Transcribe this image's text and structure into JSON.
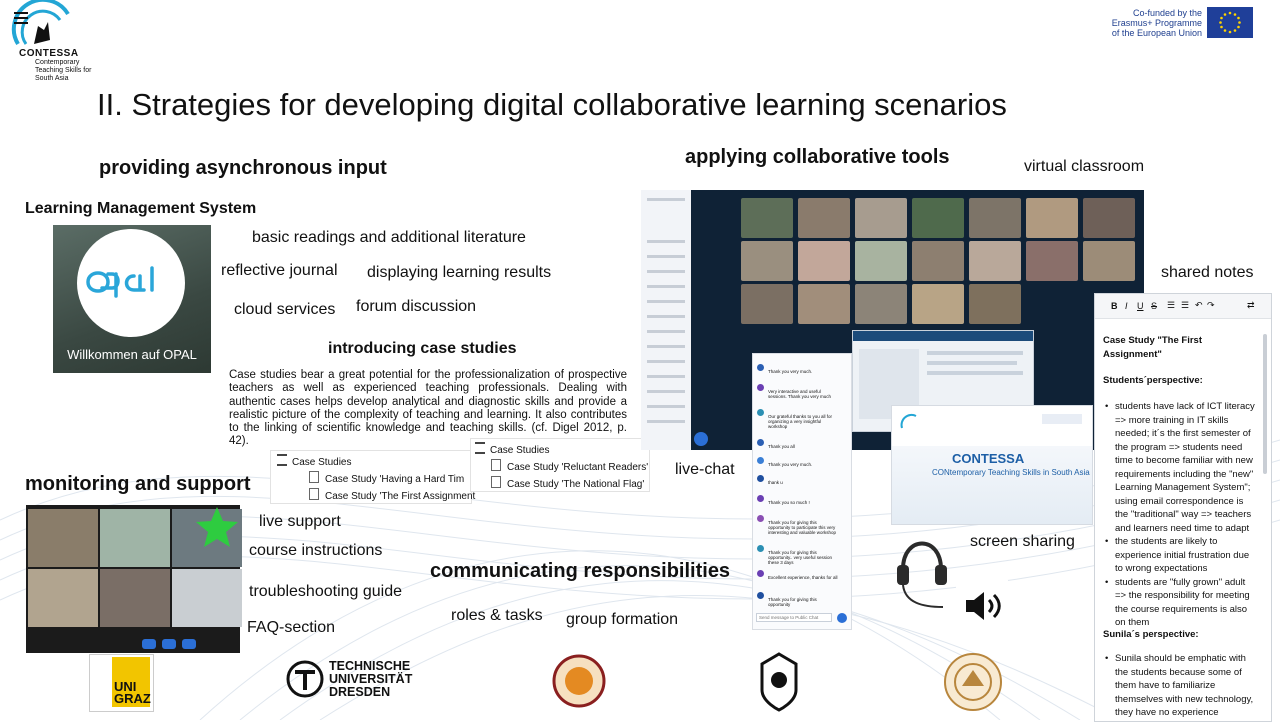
{
  "header": {
    "contessa": {
      "name": "CONTESSA",
      "subtitle": "Contemporary Teaching Skills for South Asia"
    },
    "eu_text": "Co-funded by the Erasmus+ Programme of the European Union",
    "title": "II. Strategies for developing digital collaborative learning scenarios"
  },
  "async": {
    "heading": "providing asynchronous input",
    "lms_label": "Learning Management System",
    "opal_logo_text": "Opal",
    "opal_welcome": "Willkommen auf OPAL",
    "items": [
      "basic readings and additional literature",
      "reflective journal",
      "displaying learning results",
      "cloud services",
      "forum discussion"
    ]
  },
  "case_studies": {
    "heading": "introducing case studies",
    "text": "Case studies bear a great potential for the professionalization of prospective teachers as well as experienced teaching professionals. Dealing with authentic cases helps develop analytical and diagnostic skills and provide a realistic picture of the complexity of teaching and learning. It also contributes to the linking of scientific knowledge and teaching skills. (cf. Digel 2012, p. 42).",
    "tree1": {
      "folder": "Case Studies",
      "items": [
        "Case Study 'Having a Hard Tim",
        "Case Study 'The First Assignment"
      ]
    },
    "tree2": {
      "folder": "Case Studies",
      "items": [
        "Case Study 'Reluctant Readers'",
        "Case Study 'The National Flag'"
      ]
    }
  },
  "monitoring": {
    "heading": "monitoring and support",
    "items": [
      "live support",
      "course instructions",
      "troubleshooting guide",
      "FAQ-section"
    ]
  },
  "collab": {
    "heading": "applying collaborative tools",
    "virtual_classroom": "virtual classroom",
    "shared_notes": "shared notes",
    "live_chat": "live-chat",
    "screen_sharing": "screen sharing",
    "contessa_slide": {
      "name": "CONTESSA",
      "tagline": "CONtemporary Teaching Skills in South Asia"
    }
  },
  "responsibilities": {
    "heading": "communicating responsibilities",
    "items": [
      "roles & tasks",
      "group formation"
    ]
  },
  "chat": {
    "messages": [
      "Thank you very much.",
      "Very interactive and useful sessions. Thank you very much",
      "Our grateful thanks to you all for organizing a very insightful workshop",
      "Thank you all",
      "Thank you very much.",
      "thank u",
      "Thank you so much !",
      "Thank you for giving this opportunity to participate this very interesting and valuable workshop",
      "Thank you for giving this opportunity.. very useful session these 3 days",
      "Excellent experience, thanks for all",
      "Thank you for giving this opportunity"
    ],
    "placeholder": "Send message to Public Chat"
  },
  "notes": {
    "title": "Case Study \"The First Assignment\"",
    "section1": "Students´perspective:",
    "bullets1": [
      "students have lack of ICT literacy => more training in IT skills needed; it´s the first semester of the program => students need time to become familiar with new requirements including the \"new\" Learning Management System\"; using email correspondence is the \"traditional\" way => teachers and learners need time to adapt",
      "the students are likely to experience initial frustration due to wrong expectations",
      "students are \"fully grown\" adult => the responsibility for meeting the course requirements is also on them"
    ],
    "section2": "Sunila´s perspective:",
    "bullets2": [
      "Sunila should be emphatic with the students because some of them have to familiarize themselves with new technology, they have no experience"
    ]
  },
  "partners": {
    "unigraz": "UNI GRAZ",
    "tud": "TECHNISCHE UNIVERSITÄT DRESDEN"
  },
  "colors": {
    "accent": "#1f3f99",
    "opal_blue": "#2aa6d9",
    "dark_video": "#0f2236"
  }
}
